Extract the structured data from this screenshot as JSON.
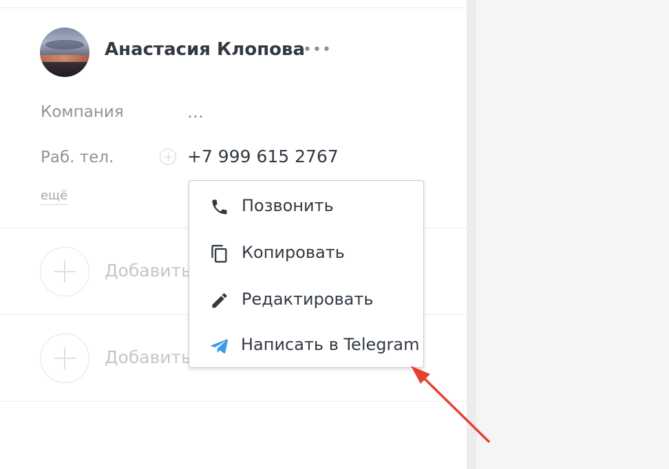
{
  "contact": {
    "name": "Анастасия Клопова",
    "more_dots": "•••"
  },
  "fields": {
    "company_label": "Компания",
    "company_value": "...",
    "phone_label": "Раб. тел.",
    "phone_value": "+7 999 615 2767",
    "more_link": "ещё"
  },
  "add_rows": [
    {
      "label": "Добавить"
    },
    {
      "label": "Добавить"
    }
  ],
  "context_menu": {
    "items": [
      {
        "label": "Позвонить",
        "icon": "phone-icon"
      },
      {
        "label": "Копировать",
        "icon": "copy-icon"
      },
      {
        "label": "Редактировать",
        "icon": "pencil-icon"
      },
      {
        "label": "Написать в Telegram",
        "icon": "telegram-icon"
      }
    ]
  },
  "colors": {
    "text": "#313942",
    "muted": "#8d9299",
    "telegram": "#3d9be9",
    "arrow": "#e8402e"
  }
}
